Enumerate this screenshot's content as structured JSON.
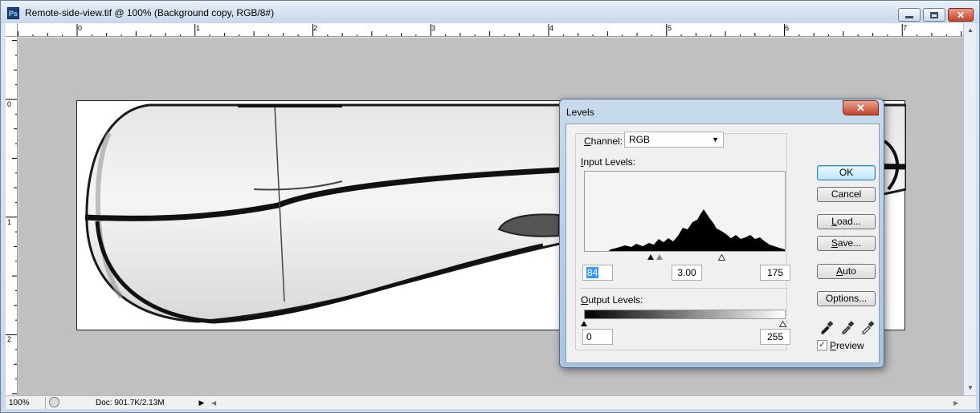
{
  "window": {
    "app_icon_text": "Ps",
    "title": "Remote-side-view.tif @ 100% (Background copy, RGB/8#)",
    "close_glyph": "✕"
  },
  "rulers": {
    "horizontal_labels": [
      "0",
      "1",
      "2",
      "3",
      "4",
      "5",
      "6",
      "7"
    ],
    "vertical_labels": [
      "0",
      "1",
      "2"
    ]
  },
  "status": {
    "zoom": "100%",
    "doc_info": "Doc: 901.7K/2.13M",
    "menu_arrow": "▶",
    "scroll_left": "◀",
    "scroll_right": "▶"
  },
  "levels_dialog": {
    "title": "Levels",
    "close_glyph": "✕",
    "channel_label_accel": "C",
    "channel_label_rest": "hannel:",
    "channel_value": "RGB",
    "input_levels_label_accel": "I",
    "input_levels_label_rest": "nput Levels:",
    "input_black": "84",
    "input_gamma": "3.00",
    "input_white": "175",
    "output_levels_label_accel": "O",
    "output_levels_label_rest": "utput Levels:",
    "output_black": "0",
    "output_white": "255",
    "buttons": {
      "ok": "OK",
      "cancel": "Cancel",
      "load_accel": "L",
      "load_rest": "oad...",
      "save_accel": "S",
      "save_rest": "ave...",
      "auto_accel": "A",
      "auto_rest": "uto",
      "options_accel": "",
      "options": "Options..."
    },
    "preview_label_accel": "P",
    "preview_label_rest": "review",
    "preview_checked": true,
    "check_glyph": "✓"
  }
}
